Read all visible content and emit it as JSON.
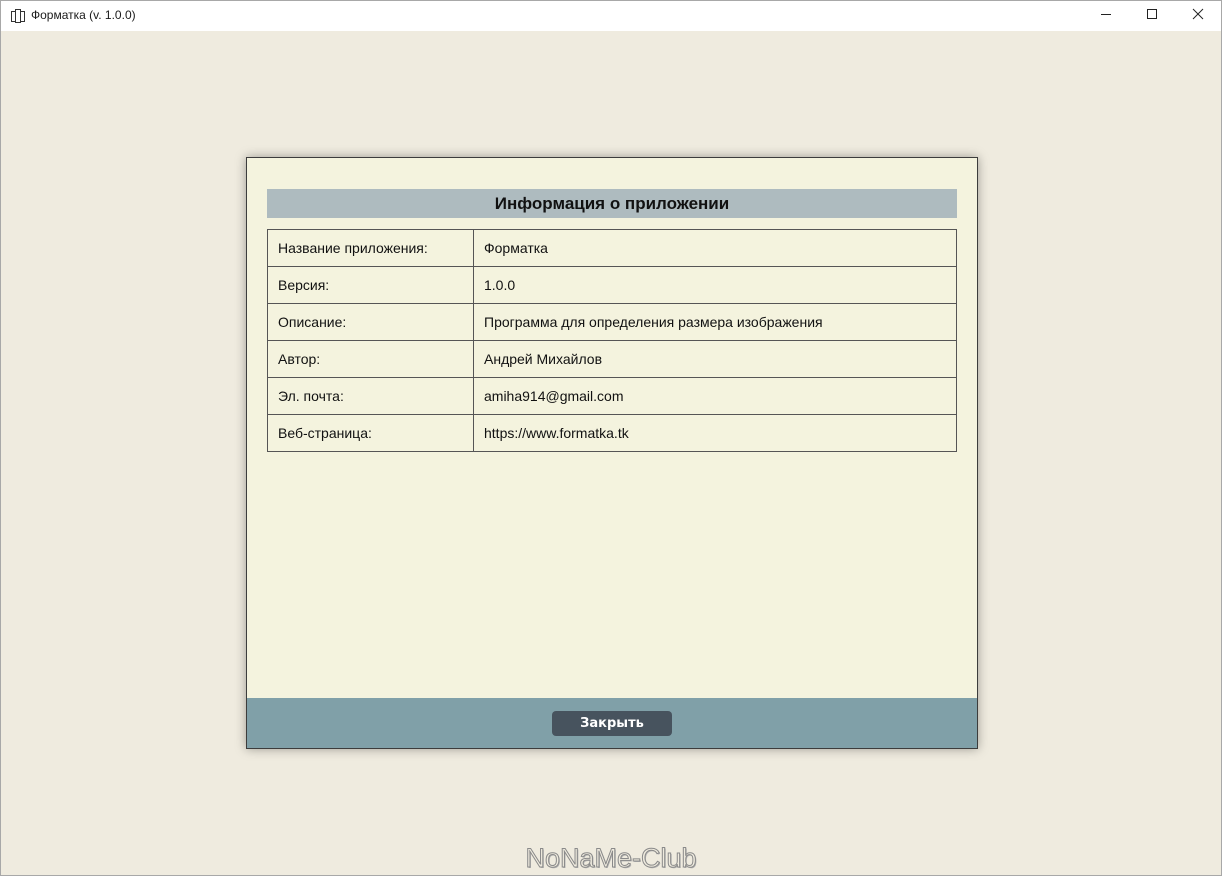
{
  "window": {
    "title": "Форматка (v. 1.0.0)"
  },
  "dialog": {
    "header": "Информация о приложении",
    "rows": [
      {
        "label": "Название приложения:",
        "value": "Форматка"
      },
      {
        "label": "Версия:",
        "value": "1.0.0"
      },
      {
        "label": "Описание:",
        "value": "Программа для определения размера изображения"
      },
      {
        "label": "Автор:",
        "value": "Андрей Михайлов"
      },
      {
        "label": "Эл. почта:",
        "value": "amiha914@gmail.com"
      },
      {
        "label": "Веб-страница:",
        "value": "https://www.formatka.tk"
      }
    ],
    "close_label": "Закрыть"
  },
  "watermark": "NoNaMe-Club",
  "icons": {
    "app": "app-window-icon",
    "minimize": "minimize-icon",
    "maximize": "maximize-icon",
    "close": "close-icon"
  },
  "colors": {
    "background": "#efebdf",
    "dialog_bg": "#f4f3de",
    "header_bg": "#aebbbf",
    "footer_bg": "#80a0a8",
    "button_bg": "#47535e"
  }
}
